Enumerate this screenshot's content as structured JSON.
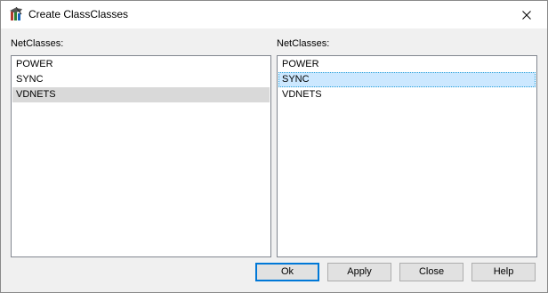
{
  "window": {
    "title": "Create ClassClasses",
    "icon": "class-classes-app-icon",
    "close_icon": "close-icon"
  },
  "left_panel": {
    "label": "NetClasses:",
    "items": [
      "POWER",
      "SYNC",
      "VDNETS"
    ],
    "selected": "VDNETS"
  },
  "right_panel": {
    "label": "NetClasses:",
    "items": [
      "POWER",
      "SYNC",
      "VDNETS"
    ],
    "selected": "SYNC"
  },
  "buttons": {
    "ok": "Ok",
    "apply": "Apply",
    "close": "Close",
    "help": "Help"
  },
  "colors": {
    "selection_focused": "#cce8ff",
    "selection_inactive": "#d9d9d9",
    "default_button_border": "#0078d7"
  }
}
